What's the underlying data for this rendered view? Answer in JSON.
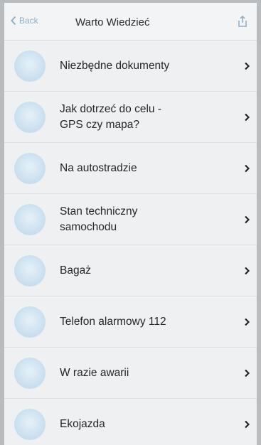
{
  "header": {
    "back_label": "Back",
    "title": "Warto Wiedzieć"
  },
  "colors": {
    "accent": "#8fb0c8",
    "row_background": "#eef0f1",
    "icon_tint": "#cde2f1"
  },
  "items": [
    {
      "label": "Niezbędne dokumenty",
      "icon": "document-icon"
    },
    {
      "label": "Jak dotrzeć do celu -\nGPS czy mapa?",
      "icon": "map-icon"
    },
    {
      "label": "Na autostradzie",
      "icon": "highway-icon"
    },
    {
      "label": "Stan techniczny\nsamochodu",
      "icon": "car-icon"
    },
    {
      "label": "Bagaż",
      "icon": "luggage-icon"
    },
    {
      "label": "Telefon alarmowy 112",
      "icon": "phone-icon"
    },
    {
      "label": "W razie awarii",
      "icon": "warning-icon"
    },
    {
      "label": "Ekojazda",
      "icon": "leaf-icon"
    }
  ]
}
